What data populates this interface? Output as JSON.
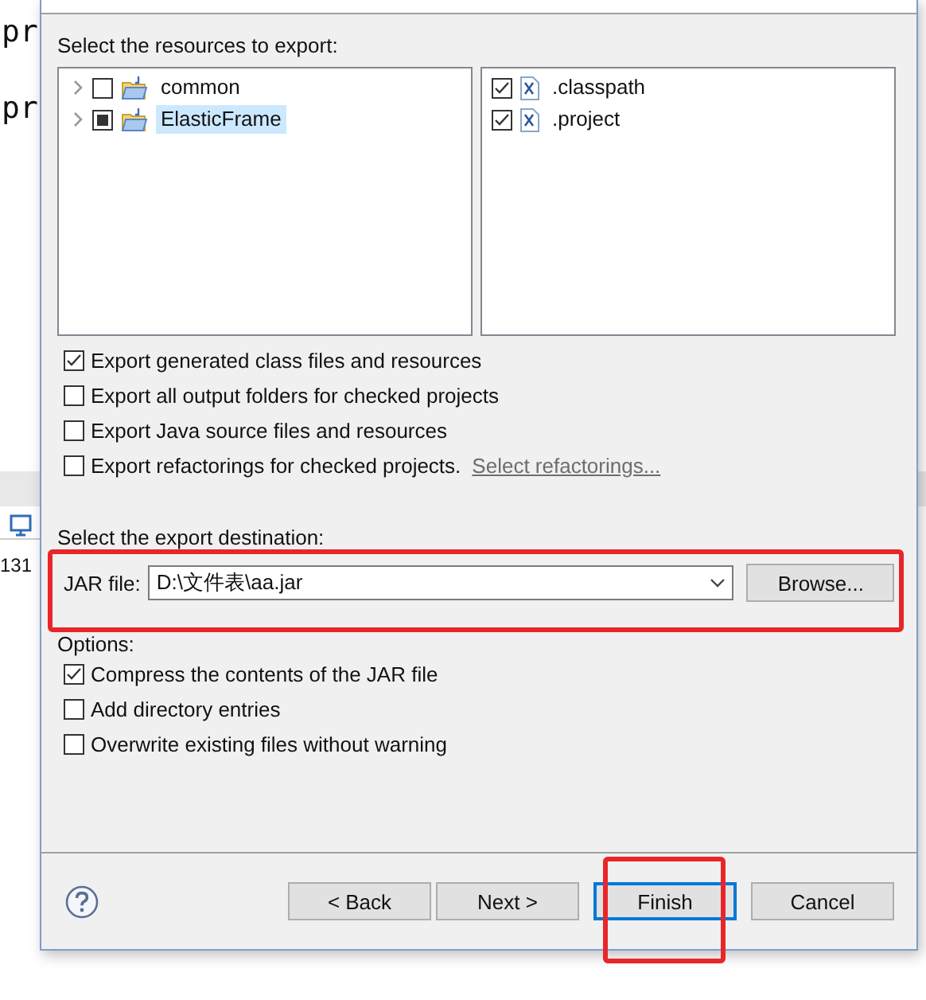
{
  "background": {
    "editor_lines": [
      "pr",
      "pr"
    ],
    "status_text": "131"
  },
  "dialog": {
    "resources_label": "Select the resources to export:",
    "projects": [
      {
        "name": "common",
        "checked": false,
        "grayed": false,
        "selected": false,
        "expanded": false
      },
      {
        "name": "ElasticFrame",
        "checked": true,
        "grayed": true,
        "selected": true,
        "expanded": false
      }
    ],
    "files": [
      {
        "name": ".classpath",
        "checked": true
      },
      {
        "name": ".project",
        "checked": true
      }
    ],
    "export_options": [
      {
        "label": "Export generated class files and resources",
        "checked": true
      },
      {
        "label": "Export all output folders for checked projects",
        "checked": false
      },
      {
        "label": "Export Java source files and resources",
        "checked": false
      },
      {
        "label": "Export refactorings for checked projects.",
        "checked": false,
        "link": "Select refactorings...",
        "link_disabled": true
      }
    ],
    "destination_label": "Select the export destination:",
    "jar_file": {
      "label": "JAR file:",
      "value": "D:\\文件表\\aa.jar"
    },
    "browse": "Browse...",
    "options_label": "Options:",
    "options": [
      {
        "label": "Compress the contents of the JAR file",
        "checked": true
      },
      {
        "label": "Add directory entries",
        "checked": false
      },
      {
        "label": "Overwrite existing files without warning",
        "checked": false
      }
    ],
    "buttons": [
      {
        "label": "< Back",
        "default": false
      },
      {
        "label": "Next >",
        "default": false
      },
      {
        "label": "Finish",
        "default": true
      },
      {
        "label": "Cancel",
        "default": false
      }
    ]
  }
}
